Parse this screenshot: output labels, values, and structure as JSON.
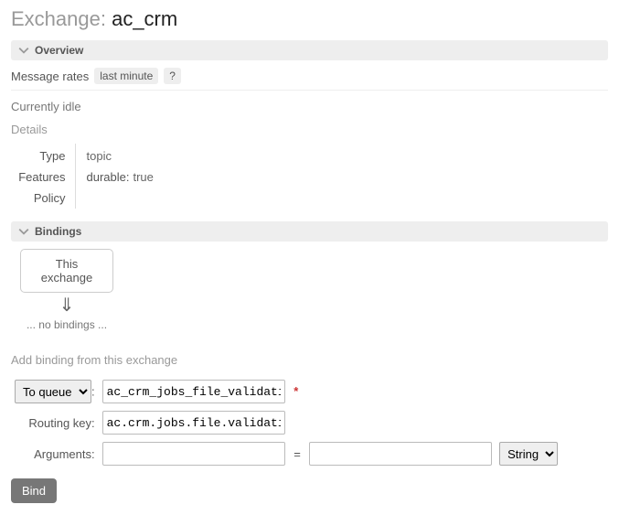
{
  "page_title_prefix": "Exchange: ",
  "exchange_name": "ac_crm",
  "sections": {
    "overview": {
      "title": "Overview"
    },
    "bindings": {
      "title": "Bindings"
    }
  },
  "overview": {
    "message_rates_label": "Message rates",
    "last_minute_tag": "last minute",
    "help_tag": "?",
    "idle_text": "Currently idle",
    "details_head": "Details",
    "rows": {
      "type_label": "Type",
      "type_value": "topic",
      "features_label": "Features",
      "durable_key": "durable:",
      "durable_value": "true",
      "policy_label": "Policy",
      "policy_value": ""
    }
  },
  "bindings": {
    "this_exchange_box": "This exchange",
    "no_bindings_text": "... no bindings ...",
    "add_head": "Add binding from this exchange",
    "dest_select_options": [
      "To queue"
    ],
    "dest_select_value": "To queue",
    "dest_colon": ":",
    "dest_input_value": "ac_crm_jobs_file_validation",
    "required_mark": "*",
    "routing_key_label": "Routing key:",
    "routing_key_value": "ac.crm.jobs.file.validation",
    "arguments_label": "Arguments:",
    "arg_key_value": "",
    "arg_eq": "=",
    "arg_val_value": "",
    "arg_type_options": [
      "String"
    ],
    "arg_type_value": "String",
    "bind_button": "Bind"
  }
}
